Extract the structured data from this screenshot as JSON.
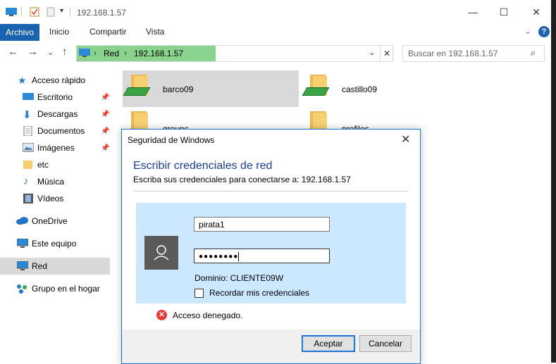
{
  "title": "192.168.1.57",
  "ribbon": {
    "file_tab": "Archivo",
    "tabs": [
      "Inicio",
      "Compartir",
      "Vista"
    ]
  },
  "address": {
    "segments": [
      "Red",
      "192.168.1.57"
    ],
    "search_placeholder": "Buscar en 192.168.1.57"
  },
  "sidebar": {
    "items": [
      {
        "label": "Acceso rápido",
        "icon": "star-icon"
      },
      {
        "label": "Escritorio",
        "icon": "desktop-icon",
        "pinned": true
      },
      {
        "label": "Descargas",
        "icon": "download-icon",
        "pinned": true
      },
      {
        "label": "Documentos",
        "icon": "document-icon",
        "pinned": true
      },
      {
        "label": "Imágenes",
        "icon": "image-icon",
        "pinned": true
      },
      {
        "label": "etc",
        "icon": "folder-icon"
      },
      {
        "label": "Música",
        "icon": "music-icon"
      },
      {
        "label": "Vídeos",
        "icon": "video-icon"
      },
      {
        "label": "OneDrive",
        "icon": "cloud-icon"
      },
      {
        "label": "Este equipo",
        "icon": "computer-icon"
      },
      {
        "label": "Red",
        "icon": "network-icon",
        "selected": true
      },
      {
        "label": "Grupo en el hogar",
        "icon": "homegroup-icon"
      }
    ]
  },
  "shares": [
    {
      "name": "barco09",
      "selected": true
    },
    {
      "name": "castillo09"
    },
    {
      "name": "groups"
    },
    {
      "name": "profiles"
    }
  ],
  "dialog": {
    "title": "Seguridad de Windows",
    "heading": "Escribir credenciales de red",
    "subheading": "Escriba sus credenciales para conectarse a: 192.168.1.57",
    "username": "pirata1",
    "password_mask": "●●●●●●●●",
    "domain": "Dominio: CLIENTE09W",
    "remember_label": "Recordar mis credenciales",
    "error": "Acceso denegado.",
    "ok_label": "Aceptar",
    "cancel_label": "Cancelar"
  },
  "colors": {
    "accent": "#1a78d4",
    "file_tab": "#1a63b0",
    "address_highlight": "#8ad38e",
    "credential_panel": "#cce8ff",
    "error": "#e43c3c"
  }
}
